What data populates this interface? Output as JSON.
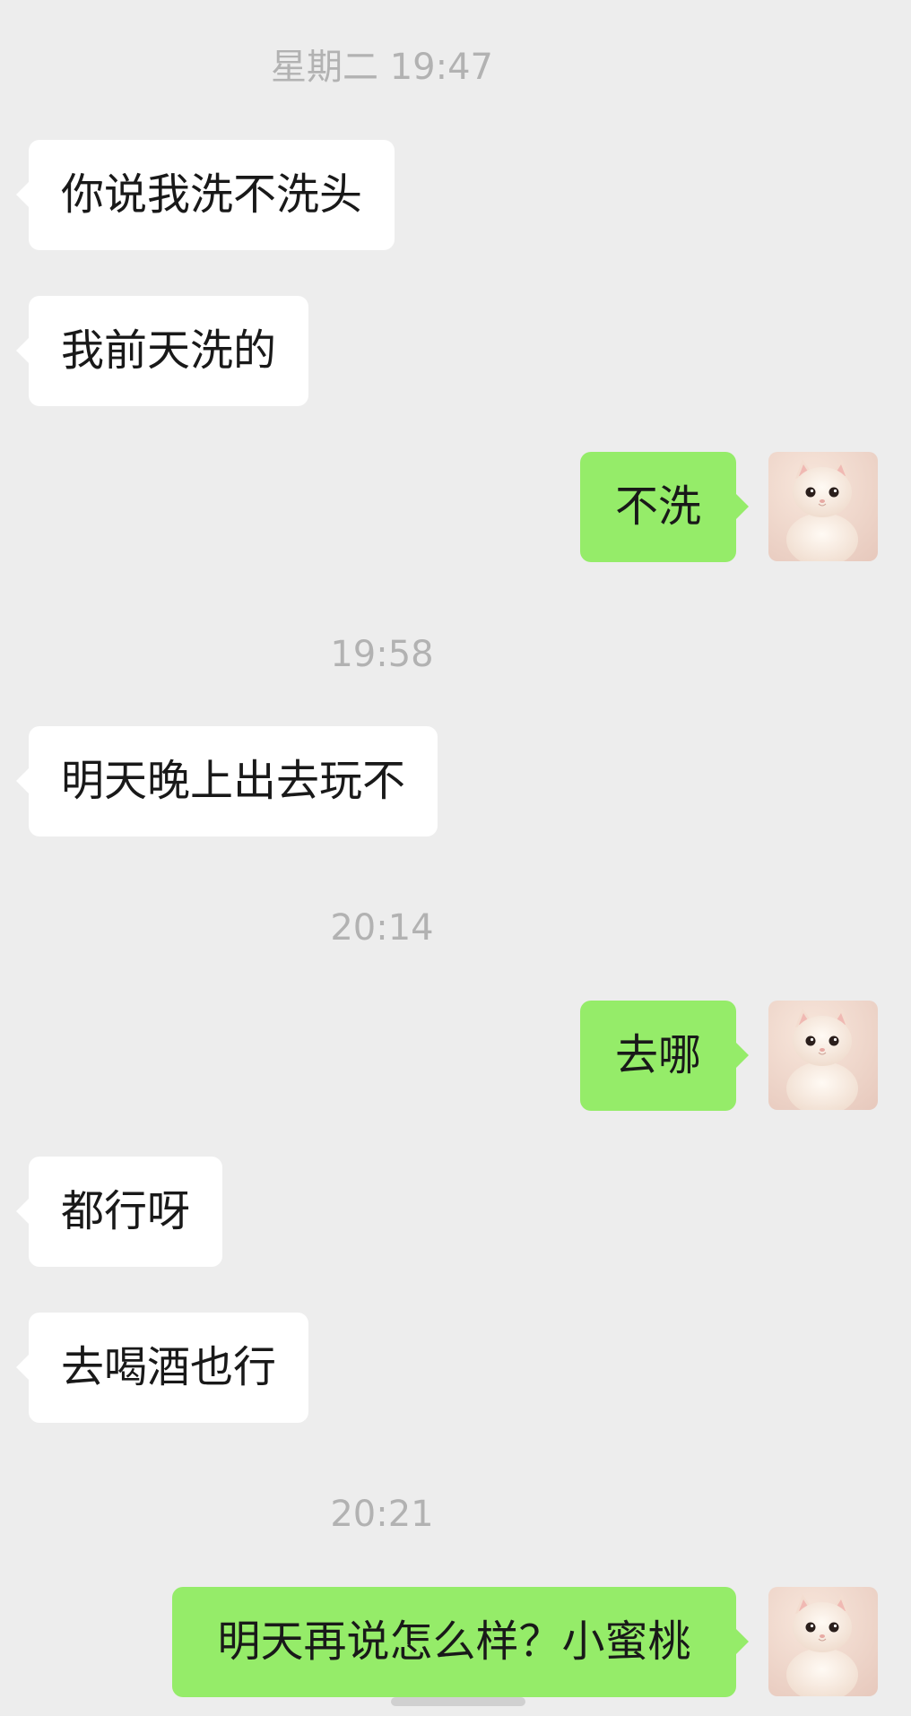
{
  "messages": {
    "ts1": "星期二 19:47",
    "m1": "你说我洗不洗头",
    "m2": "我前天洗的",
    "m3": "不洗",
    "ts2": "19:58",
    "m4": "明天晚上出去玩不",
    "ts3": "20:14",
    "m5": "去哪",
    "m6": "都行呀",
    "m7": "去喝酒也行",
    "ts4": "20:21",
    "m8": "明天再说怎么样？小蜜桃"
  },
  "avatar": {
    "icon": "cat-avatar-icon",
    "alt": "self avatar"
  },
  "colors": {
    "background": "#ededed",
    "incoming_bubble": "#ffffff",
    "outgoing_bubble": "#95ec69",
    "timestamp_text": "#b2b2b2",
    "message_text": "#191919"
  }
}
